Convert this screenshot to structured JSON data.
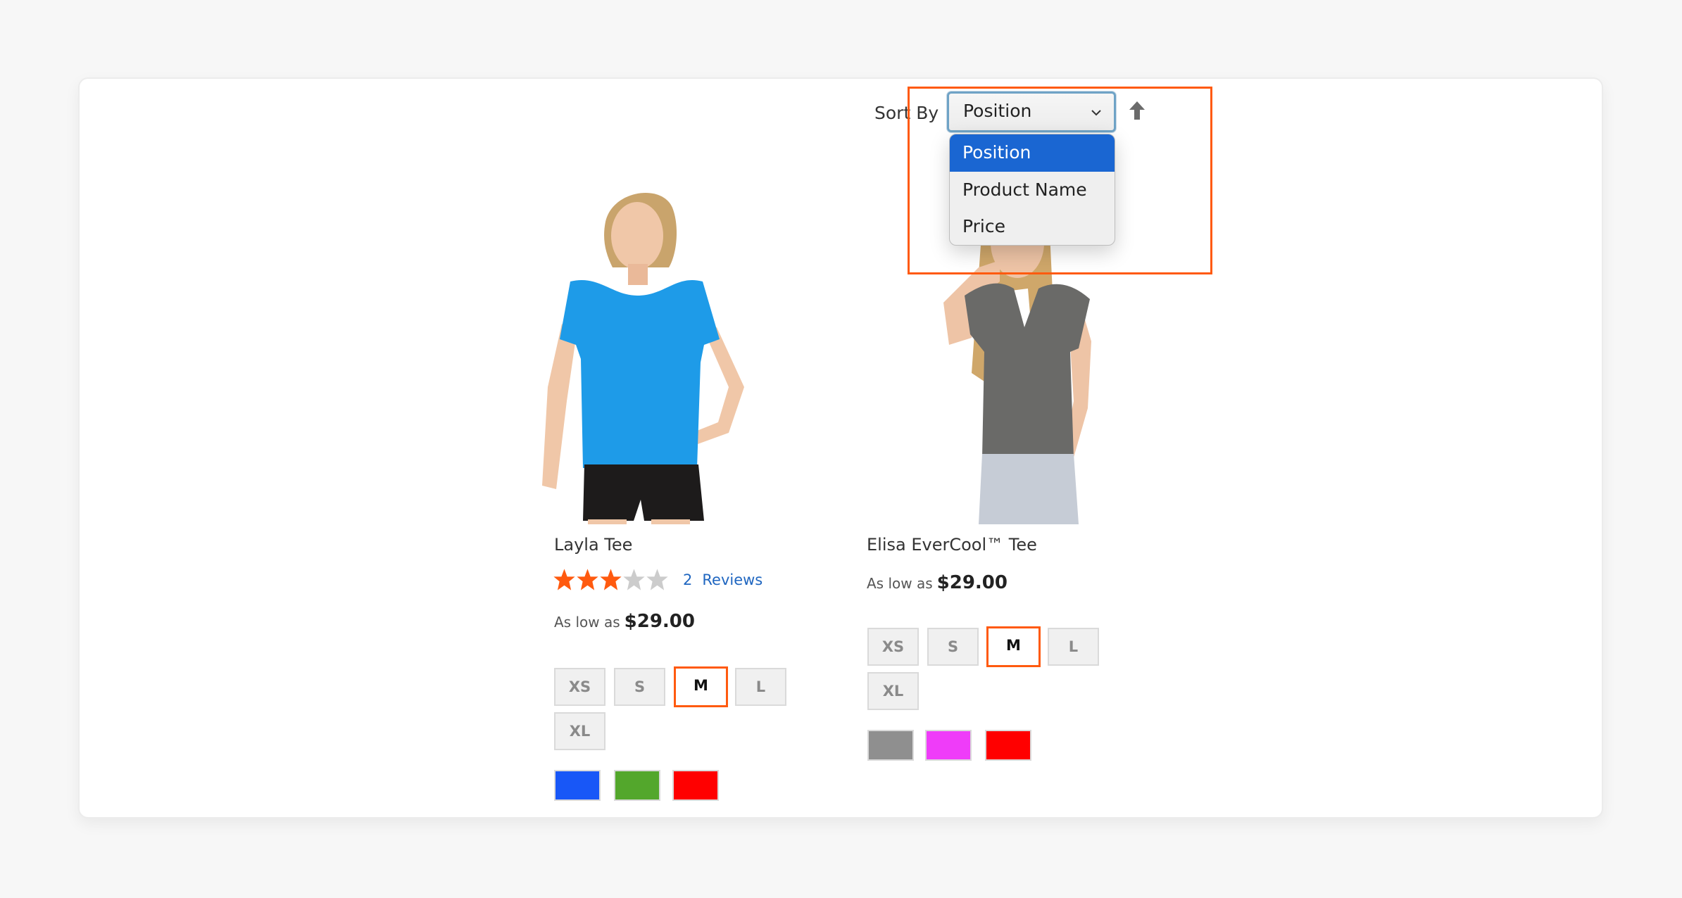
{
  "toolbar": {
    "sort_label": "Sort By",
    "selected_sort": "Position",
    "sort_options": [
      "Position",
      "Product Name",
      "Price"
    ],
    "sort_direction_icon": "arrow-up-icon"
  },
  "products": [
    {
      "name": "Layla Tee",
      "rating": {
        "stars": 3,
        "max": 5,
        "count": "2",
        "label": "Reviews"
      },
      "price_prefix": "As low as",
      "price": "$29.00",
      "sizes": [
        "XS",
        "S",
        "M",
        "L",
        "XL"
      ],
      "selected_size": "M",
      "colors": [
        "#1857f7",
        "#53a72c",
        "#ff0000"
      ],
      "image_colors": {
        "shirt": "#1e9be8",
        "shorts": "#1d1b1b",
        "skin": "#f0c7a8",
        "hair": "#c9a46c"
      }
    },
    {
      "name": "Elisa EverCool™ Tee",
      "price_prefix": "As low as",
      "price": "$29.00",
      "sizes": [
        "XS",
        "S",
        "M",
        "L",
        "XL"
      ],
      "selected_size": "M",
      "colors": [
        "#8f8f8f",
        "#ef3cf9",
        "#ff0000"
      ],
      "image_colors": {
        "shirt": "#6a6a68",
        "pants": "#c6ccd6",
        "skin": "#eec4a6",
        "hair": "#cfa76a"
      }
    }
  ],
  "colors": {
    "highlight": "#ff5a0f",
    "selected_option": "#1a66d2",
    "star_filled": "#ff5a0f",
    "star_empty": "#cccccc",
    "link": "#1f66c0"
  }
}
